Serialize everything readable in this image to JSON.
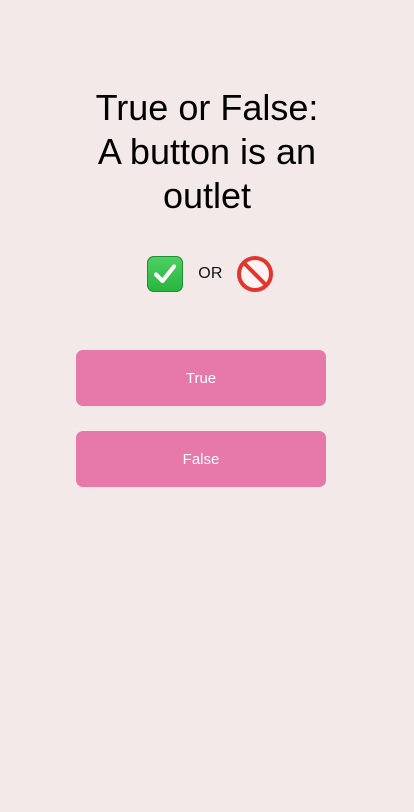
{
  "question": {
    "line1": "True or False:",
    "line2": "A button is an",
    "line3": "outlet"
  },
  "choices": {
    "true_icon": "check-mark-button-icon",
    "separator": "OR",
    "false_icon": "prohibited-icon"
  },
  "buttons": {
    "true_label": "True",
    "false_label": "False"
  },
  "colors": {
    "background": "#f4e9e9",
    "button": "#e678aa",
    "button_text": "#ffffff"
  }
}
